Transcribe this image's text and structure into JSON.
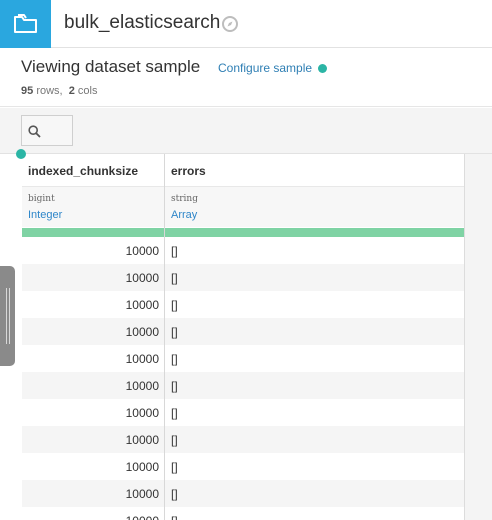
{
  "header": {
    "dataset_name": "bulk_elasticsearch"
  },
  "summary": {
    "title": "Viewing dataset sample",
    "configure_label": "Configure sample",
    "rows_count": "95",
    "rows_label": "rows,",
    "cols_count": "2",
    "cols_label": "cols"
  },
  "columns": [
    {
      "name": "indexed_chunksize",
      "storage_type": "bigint",
      "meaning": "Integer"
    },
    {
      "name": "errors",
      "storage_type": "string",
      "meaning": "Array"
    }
  ],
  "rows": [
    [
      "10000",
      "[]"
    ],
    [
      "10000",
      "[]"
    ],
    [
      "10000",
      "[]"
    ],
    [
      "10000",
      "[]"
    ],
    [
      "10000",
      "[]"
    ],
    [
      "10000",
      "[]"
    ],
    [
      "10000",
      "[]"
    ],
    [
      "10000",
      "[]"
    ],
    [
      "10000",
      "[]"
    ],
    [
      "10000",
      "[]"
    ],
    [
      "10000",
      "[]"
    ]
  ],
  "colors": {
    "accent": "#2aa7df",
    "teal": "#2bb5a5",
    "quality_ok": "#7fd3a4",
    "link": "#2e86c9"
  },
  "icons": {
    "header": "folder-icon",
    "dataset": "compass-icon",
    "search": "search-icon"
  }
}
